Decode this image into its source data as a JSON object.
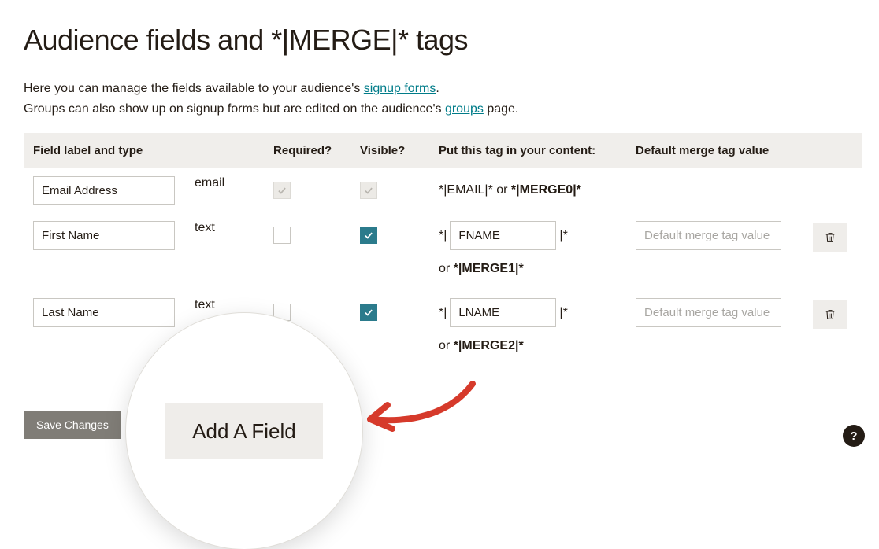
{
  "title": "Audience fields and *|MERGE|* tags",
  "intro": {
    "line1a": "Here you can manage the fields available to your audience's ",
    "link1": "signup forms",
    "line1b": ".",
    "line2a": "Groups can also show up on signup forms but are edited on the audience's ",
    "link2": "groups",
    "line2b": " page."
  },
  "headers": {
    "label": "Field label and type",
    "required": "Required?",
    "visible": "Visible?",
    "tag": "Put this tag in your content:",
    "default": "Default merge tag value"
  },
  "rows": [
    {
      "label": "Email Address",
      "type": "email",
      "tag_static": "*|EMAIL|* or ",
      "tag_bold": "*|MERGE0|*"
    },
    {
      "label": "First Name",
      "type": "text",
      "tag_prefix": "*|",
      "tag_name": "FNAME",
      "tag_suffix": "|*",
      "or_line": "or ",
      "merge_bold": "*|MERGE1|*",
      "default_placeholder": "Default merge tag value"
    },
    {
      "label": "Last Name",
      "type": "text",
      "tag_prefix": "*|",
      "tag_name": "LNAME",
      "tag_suffix": "|*",
      "or_line": "or ",
      "merge_bold": "*|MERGE2|*",
      "default_placeholder": "Default merge tag value"
    }
  ],
  "buttons": {
    "add_field": "Add A Field",
    "save": "Save Changes",
    "help": "?"
  }
}
